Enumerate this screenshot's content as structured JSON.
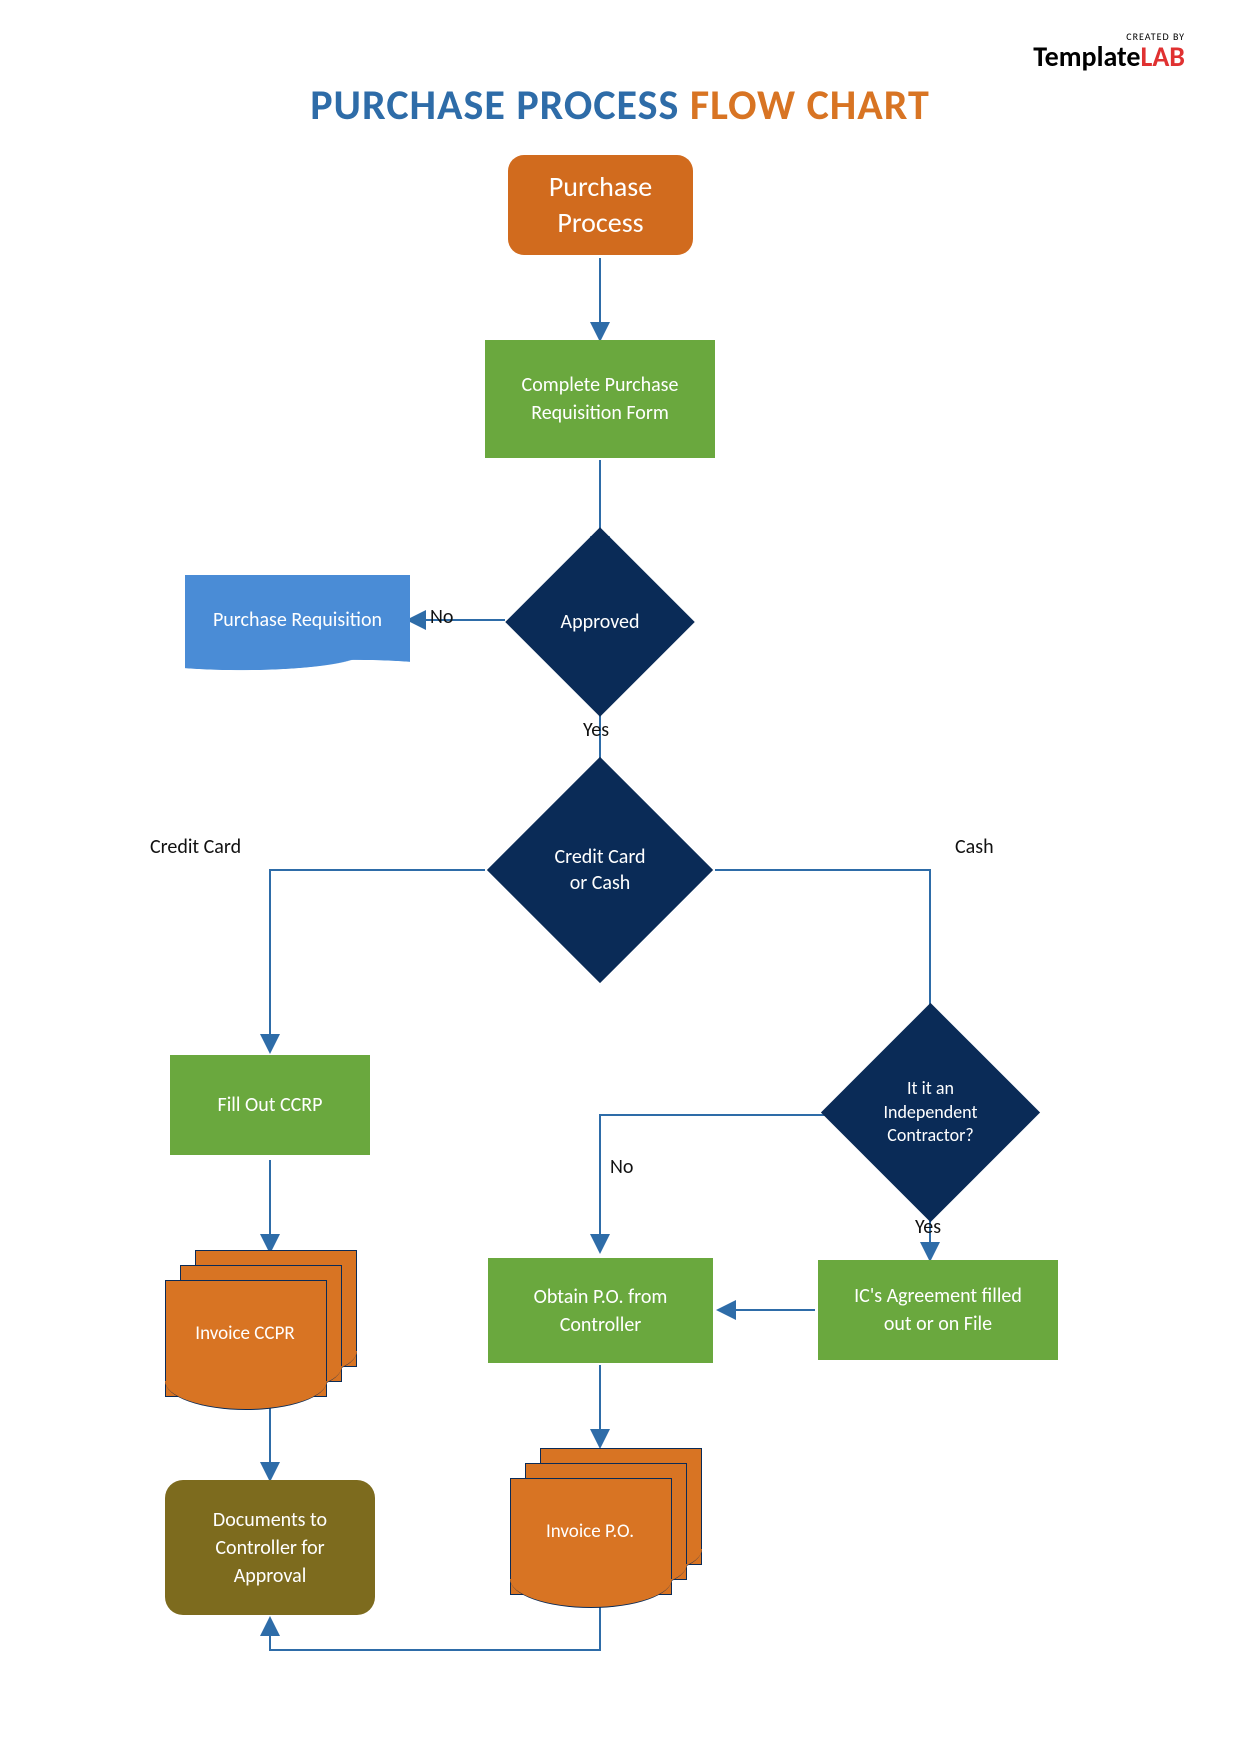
{
  "logo": {
    "created_by": "CREATED BY",
    "brand_1": "Template",
    "brand_2": "LAB"
  },
  "title": {
    "part1": "PURCHASE PROCESS ",
    "part2": "FLOW CHART"
  },
  "nodes": {
    "start": "Purchase\nProcess",
    "requisition_form": "Complete Purchase\nRequisition Form",
    "approved": "Approved",
    "purchase_requisition": "Purchase Requisition",
    "credit_or_cash": "Credit Card\nor Cash",
    "fill_ccrp": "Fill Out CCRP",
    "independent_contractor": "It it an\nIndependent\nContractor?",
    "obtain_po": "Obtain P.O. from\nController",
    "ic_agreement": "IC's Agreement filled\nout or on File",
    "invoice_ccpr": "Invoice CCPR",
    "invoice_po": "Invoice P.O.",
    "documents_approval": "Documents to\nController for\nApproval"
  },
  "labels": {
    "no1": "No",
    "yes1": "Yes",
    "credit_card": "Credit Card",
    "cash": "Cash",
    "no2": "No",
    "yes2": "Yes"
  }
}
